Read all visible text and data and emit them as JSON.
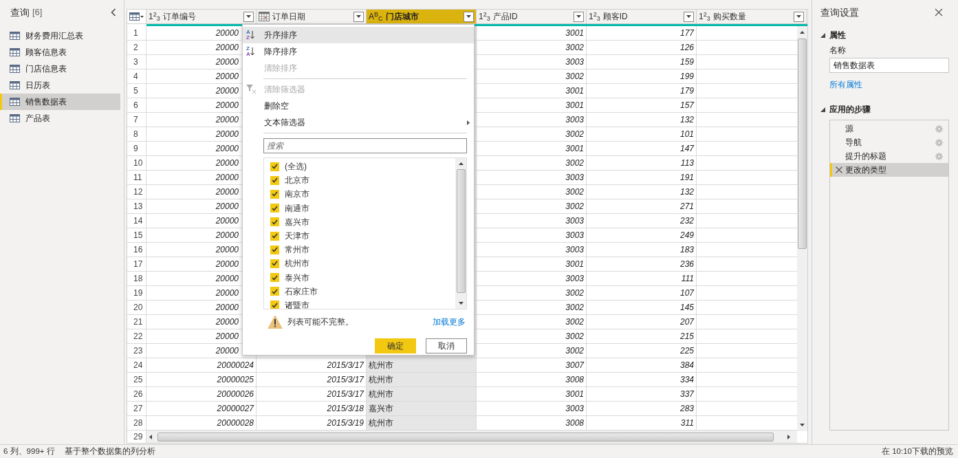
{
  "sidebar": {
    "title": "查询",
    "count": "[6]",
    "items": [
      {
        "label": "财务费用汇总表",
        "selected": false
      },
      {
        "label": "顾客信息表",
        "selected": false
      },
      {
        "label": "门店信息表",
        "selected": false
      },
      {
        "label": "日历表",
        "selected": false
      },
      {
        "label": "销售数据表",
        "selected": true
      },
      {
        "label": "产品表",
        "selected": false
      }
    ]
  },
  "table": {
    "columns": [
      {
        "kind": "number",
        "type_label": "1$^{2}$$_{3}$",
        "name": "订单编号",
        "selected": false
      },
      {
        "kind": "date",
        "name": "订单日期",
        "selected": false
      },
      {
        "kind": "text",
        "type_label": "A$^{B}$$_{C}$",
        "name": "门店城市",
        "selected": true
      },
      {
        "kind": "number",
        "type_label": "1$^{2}$$_{3}$",
        "name": "产品ID",
        "selected": false
      },
      {
        "kind": "number",
        "type_label": "1$^{2}$$_{3}$",
        "name": "顾客ID",
        "selected": false
      },
      {
        "kind": "number",
        "type_label": "1$^{2}$$_{3}$",
        "name": "购买数量",
        "selected": false
      }
    ],
    "rows": [
      {
        "number": "1",
        "order_id": "20000",
        "product_id": "3001",
        "customer_id": "177"
      },
      {
        "number": "2",
        "order_id": "20000",
        "product_id": "3002",
        "customer_id": "126"
      },
      {
        "number": "3",
        "order_id": "20000",
        "product_id": "3003",
        "customer_id": "159"
      },
      {
        "number": "4",
        "order_id": "20000",
        "product_id": "3002",
        "customer_id": "199"
      },
      {
        "number": "5",
        "order_id": "20000",
        "product_id": "3001",
        "customer_id": "179"
      },
      {
        "number": "6",
        "order_id": "20000",
        "product_id": "3001",
        "customer_id": "157"
      },
      {
        "number": "7",
        "order_id": "20000",
        "product_id": "3003",
        "customer_id": "132"
      },
      {
        "number": "8",
        "order_id": "20000",
        "product_id": "3002",
        "customer_id": "101"
      },
      {
        "number": "9",
        "order_id": "20000",
        "product_id": "3001",
        "customer_id": "147"
      },
      {
        "number": "10",
        "order_id": "20000",
        "product_id": "3002",
        "customer_id": "113"
      },
      {
        "number": "11",
        "order_id": "20000",
        "product_id": "3003",
        "customer_id": "191"
      },
      {
        "number": "12",
        "order_id": "20000",
        "product_id": "3002",
        "customer_id": "132"
      },
      {
        "number": "13",
        "order_id": "20000",
        "product_id": "3002",
        "customer_id": "271"
      },
      {
        "number": "14",
        "order_id": "20000",
        "product_id": "3003",
        "customer_id": "232"
      },
      {
        "number": "15",
        "order_id": "20000",
        "product_id": "3003",
        "customer_id": "249"
      },
      {
        "number": "16",
        "order_id": "20000",
        "product_id": "3003",
        "customer_id": "183"
      },
      {
        "number": "17",
        "order_id": "20000",
        "product_id": "3001",
        "customer_id": "236"
      },
      {
        "number": "18",
        "order_id": "20000",
        "product_id": "3003",
        "customer_id": "111"
      },
      {
        "number": "19",
        "order_id": "20000",
        "product_id": "3002",
        "customer_id": "107"
      },
      {
        "number": "20",
        "order_id": "20000",
        "product_id": "3002",
        "customer_id": "145"
      },
      {
        "number": "21",
        "order_id": "20000",
        "product_id": "3002",
        "customer_id": "207"
      },
      {
        "number": "22",
        "order_id": "20000",
        "product_id": "3002",
        "customer_id": "215"
      },
      {
        "number": "23",
        "order_id": "20000",
        "product_id": "3002",
        "customer_id": "225"
      },
      {
        "number": "24",
        "order_id": "20000024",
        "date": "2015/3/17",
        "city": "杭州市",
        "product_id": "3007",
        "customer_id": "384"
      },
      {
        "number": "25",
        "order_id": "20000025",
        "date": "2015/3/17",
        "city": "杭州市",
        "product_id": "3008",
        "customer_id": "334"
      },
      {
        "number": "26",
        "order_id": "20000026",
        "date": "2015/3/17",
        "city": "杭州市",
        "product_id": "3001",
        "customer_id": "337"
      },
      {
        "number": "27",
        "order_id": "20000027",
        "date": "2015/3/18",
        "city": "嘉兴市",
        "product_id": "3003",
        "customer_id": "283"
      },
      {
        "number": "28",
        "order_id": "20000028",
        "date": "2015/3/19",
        "city": "杭州市",
        "product_id": "3008",
        "customer_id": "311"
      }
    ],
    "last_row_number": "29"
  },
  "filter_menu": {
    "items": [
      {
        "kind": "sort",
        "icon_letters": [
          "A",
          "Z"
        ],
        "label": "升序排序",
        "disabled": false,
        "highlighted": true
      },
      {
        "kind": "sort",
        "icon_letters": [
          "Z",
          "A"
        ],
        "label": "降序排序",
        "disabled": false,
        "highlighted": false
      },
      {
        "kind": "plain",
        "label": "清除排序",
        "disabled": true,
        "highlighted": false
      },
      {
        "kind": "divider"
      },
      {
        "kind": "clear_filter",
        "label": "清除筛选器",
        "disabled": true,
        "highlighted": false
      },
      {
        "kind": "plain",
        "label": "删除空",
        "disabled": false,
        "highlighted": false
      },
      {
        "kind": "submenu",
        "label": "文本筛选器",
        "disabled": false,
        "highlighted": false
      },
      {
        "kind": "divider"
      }
    ],
    "search": {
      "placeholder": "搜索"
    },
    "values": [
      {
        "label": "(全选)",
        "checked": true
      },
      {
        "label": "北京市",
        "checked": true
      },
      {
        "label": "南京市",
        "checked": true
      },
      {
        "label": "南通市",
        "checked": true
      },
      {
        "label": "嘉兴市",
        "checked": true
      },
      {
        "label": "天津市",
        "checked": true
      },
      {
        "label": "常州市",
        "checked": true
      },
      {
        "label": "杭州市",
        "checked": true
      },
      {
        "label": "泰兴市",
        "checked": true
      },
      {
        "label": "石家庄市",
        "checked": true
      },
      {
        "label": "诸暨市",
        "checked": true
      }
    ],
    "warning": "列表可能不完整。",
    "load_more": "加载更多",
    "ok": "确定",
    "cancel": "取消"
  },
  "settings": {
    "title": "查询设置",
    "properties": {
      "title": "属性",
      "expanded": true,
      "name_label": "名称",
      "name_value": "销售数据表",
      "all_properties": "所有属性"
    },
    "steps": {
      "title": "应用的步骤",
      "expanded": true,
      "items": [
        {
          "label": "源",
          "selected": false,
          "has_settings": true
        },
        {
          "label": "导航",
          "selected": false,
          "has_settings": true
        },
        {
          "label": "提升的标题",
          "selected": false,
          "has_settings": true
        },
        {
          "label": "更改的类型",
          "selected": true,
          "has_settings": false
        }
      ]
    }
  },
  "status_bar": {
    "left": [
      "6 列、999+ 行",
      "基于整个数据集的列分析"
    ],
    "right": "在 10:10下载的预览"
  }
}
